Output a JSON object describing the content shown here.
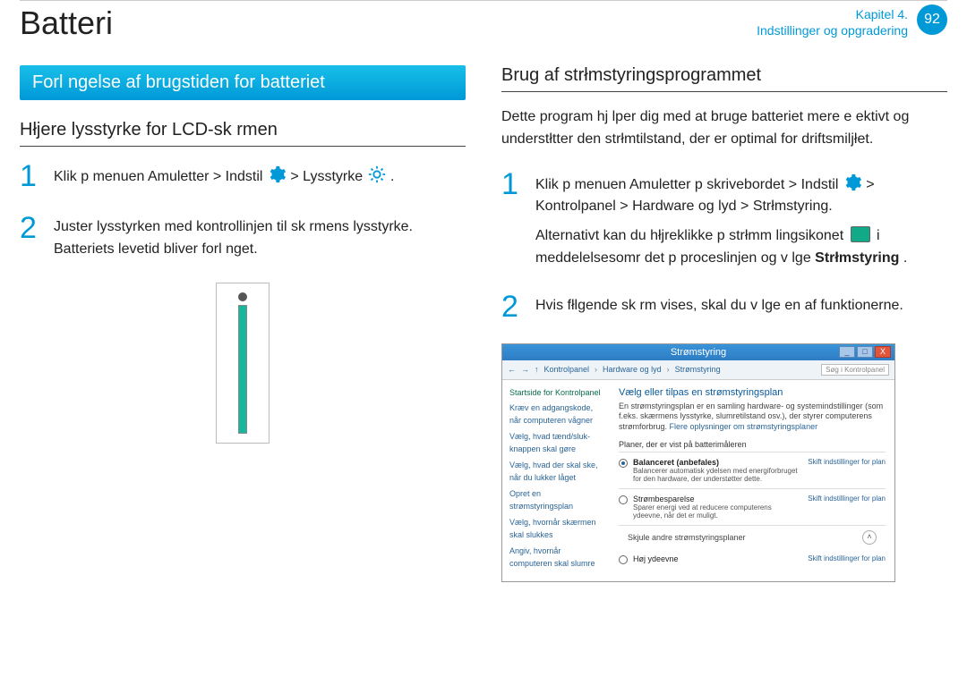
{
  "header": {
    "title": "Batteri",
    "chapter_line1": "Kapitel 4.",
    "chapter_line2": "Indstillinger og opgradering",
    "page_number": "92"
  },
  "left": {
    "band": "Forl ngelse af brugstiden for batteriet",
    "sub": "Hłjere lysstyrke for LCD-sk rmen",
    "step1_pre": "Klik p  menuen Amuletter > Indstil ",
    "step1_mid": " > Lysstyrke ",
    "step1_end": " .",
    "step2_a": "Juster lysstyrken med kontrollinjen til sk rmens lysstyrke.",
    "step2_b": "Batteriets levetid bliver forl nget."
  },
  "right": {
    "sub": "Brug af strłmstyringsprogrammet",
    "desc": "Dette program hj lper dig med at bruge batteriet mere e ektivt og understłtter den strłmtilstand, der er optimal for driftsmiljłet.",
    "step1_a": "Klik p  menuen Amuletter p  skrivebordet > Indstil ",
    "step1_b": " > Kontrolpanel > Hardware og lyd > Strłmstyring.",
    "step1_c": "Alternativt kan du hłjreklikke p  strłmm lingsikonet ",
    "step1_d": " i meddelelsesomr det p  proceslinjen og v lge ",
    "step1_e": "Strłmstyring",
    "step1_f": " .",
    "step2": "Hvis fłlgende sk rm vises, skal du v lge en af funktionerne."
  },
  "cp": {
    "title": "Strømstyring",
    "nav": {
      "back": "←",
      "fwd": "→",
      "up": "↑",
      "c1": "Kontrolpanel",
      "c2": "Hardware og lyd",
      "c3": "Strømstyring",
      "search": "Søg i Kontrolpanel"
    },
    "side": {
      "h": "Startside for Kontrolpanel",
      "l1": "Kræv en adgangskode, når computeren vågner",
      "l2": "Vælg, hvad tænd/sluk-knappen skal gøre",
      "l3": "Vælg, hvad der skal ske, når du lukker låget",
      "l4": "Opret en strømstyringsplan",
      "l5": "Vælg, hvornår skærmen skal slukkes",
      "l6": "Angiv, hvornår computeren skal slumre"
    },
    "main": {
      "h": "Vælg eller tilpas en strømstyringsplan",
      "t": "En strømstyringsplan er en samling hardware- og systemindstillinger (som f.eks. skærmens lysstyrke, slumretilstand osv.), der styrer computerens strømforbrug. ",
      "tlink": "Flere oplysninger om strømstyringsplaner",
      "group": "Planer, der er vist på batterimåleren",
      "p1_name": "Balanceret (anbefales)",
      "p1_desc": "Balancerer automatisk ydelsen med energiforbruget for den hardware, der understøtter dette.",
      "p2_name": "Strømbesparelse",
      "p2_desc": "Sparer energi ved at reducere computerens ydeevne, når det er muligt.",
      "plan_link": "Skift indstillinger for plan",
      "foot": "Skjule andre strømstyringsplaner",
      "p3_name": "Høj ydeevne"
    }
  }
}
